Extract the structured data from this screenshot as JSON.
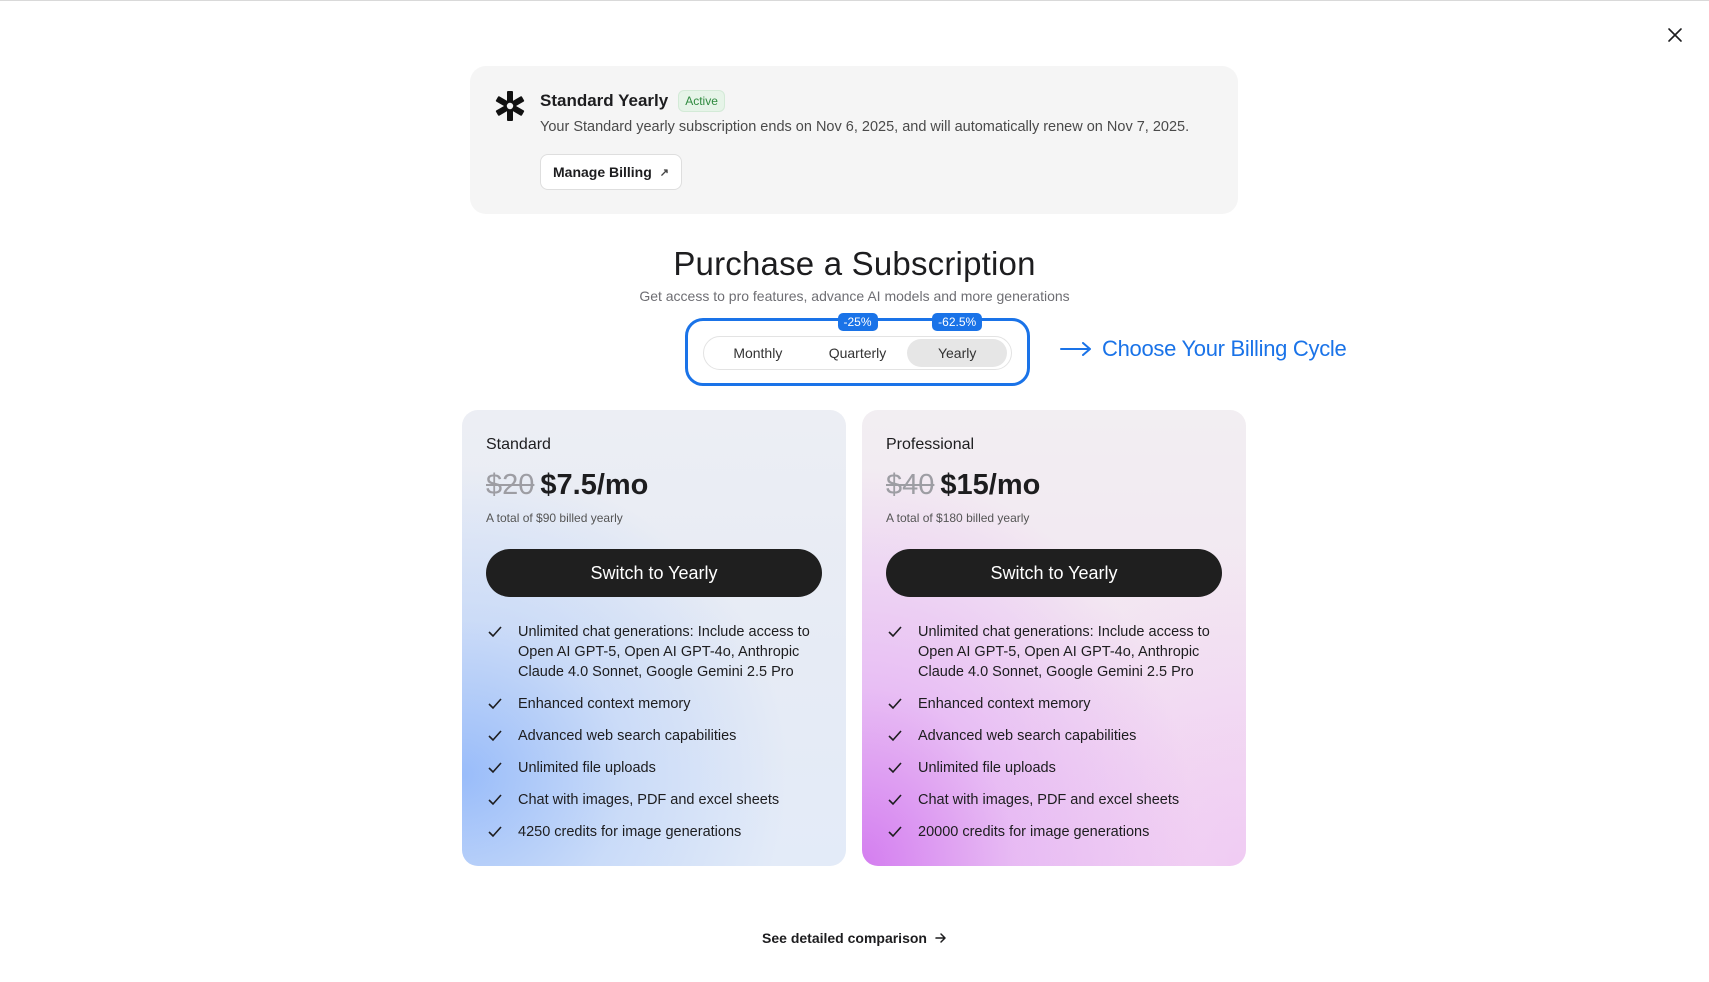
{
  "current_plan": {
    "title": "Standard Yearly",
    "status": "Active",
    "description": "Your Standard yearly subscription ends on Nov 6, 2025, and will automatically renew on Nov 7, 2025.",
    "manage_label": "Manage Billing",
    "manage_arrow": "↗"
  },
  "heading": "Purchase a Subscription",
  "subheading": "Get access to pro features, advance AI models and more generations",
  "billing_cycle": {
    "options": [
      {
        "label": "Monthly",
        "discount": ""
      },
      {
        "label": "Quarterly",
        "discount": "-25%"
      },
      {
        "label": "Yearly",
        "discount": "-62.5%"
      }
    ],
    "selected": "Yearly",
    "annotation": "Choose Your Billing Cycle"
  },
  "plans": [
    {
      "name": "Standard",
      "old_price": "$20",
      "price": "$7.5/mo",
      "billed": "A total of $90 billed yearly",
      "cta": "Switch to Yearly",
      "features": [
        "Unlimited chat generations: Include access to Open AI GPT-5, Open AI GPT-4o, Anthropic Claude 4.0 Sonnet, Google Gemini 2.5 Pro",
        "Enhanced context memory",
        "Advanced web search capabilities",
        "Unlimited file uploads",
        "Chat with images, PDF and excel sheets",
        "4250 credits for image generations"
      ]
    },
    {
      "name": "Professional",
      "old_price": "$40",
      "price": "$15/mo",
      "billed": "A total of $180 billed yearly",
      "cta": "Switch to Yearly",
      "features": [
        "Unlimited chat generations: Include access to Open AI GPT-5, Open AI GPT-4o, Anthropic Claude 4.0 Sonnet, Google Gemini 2.5 Pro",
        "Enhanced context memory",
        "Advanced web search capabilities",
        "Unlimited file uploads",
        "Chat with images, PDF and excel sheets",
        "20000 credits for image generations"
      ]
    }
  ],
  "comparison_link": "See detailed comparison",
  "colors": {
    "accent": "#1a73e8",
    "active_badge": "#2f8a3f",
    "button_dark": "#1f1f1f"
  },
  "icons": {
    "close": "close-icon",
    "logo": "asterisk-logo-icon",
    "external": "arrow-up-right-icon",
    "check": "check-icon",
    "arrow": "arrow-right-icon"
  }
}
